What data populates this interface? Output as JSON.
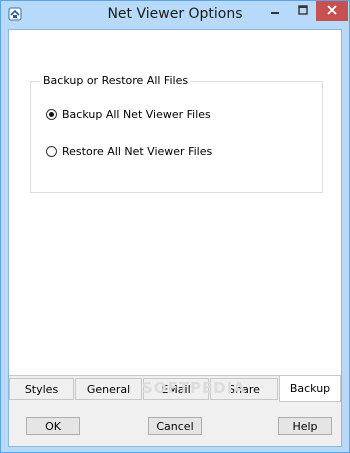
{
  "window": {
    "title": "Net Viewer Options"
  },
  "titlebar": {
    "icons": {
      "app": "app-icon",
      "minimize": "minimize-icon",
      "maximize": "maximize-icon",
      "close": "close-icon"
    },
    "close_color": "#c75050"
  },
  "group": {
    "legend": "Backup or Restore All Files",
    "options": [
      {
        "label": "Backup All Net Viewer Files",
        "selected": true
      },
      {
        "label": "Restore All Net Viewer Files",
        "selected": false
      }
    ]
  },
  "tabs": [
    {
      "label": "Styles",
      "active": false
    },
    {
      "label": "General",
      "active": false
    },
    {
      "label": "EMail",
      "active": false
    },
    {
      "label": "Share",
      "active": false
    },
    {
      "label": "Backup",
      "active": true
    }
  ],
  "watermark": "SOFTPEDIA",
  "buttons": {
    "ok": "OK",
    "cancel": "Cancel",
    "help": "Help"
  }
}
